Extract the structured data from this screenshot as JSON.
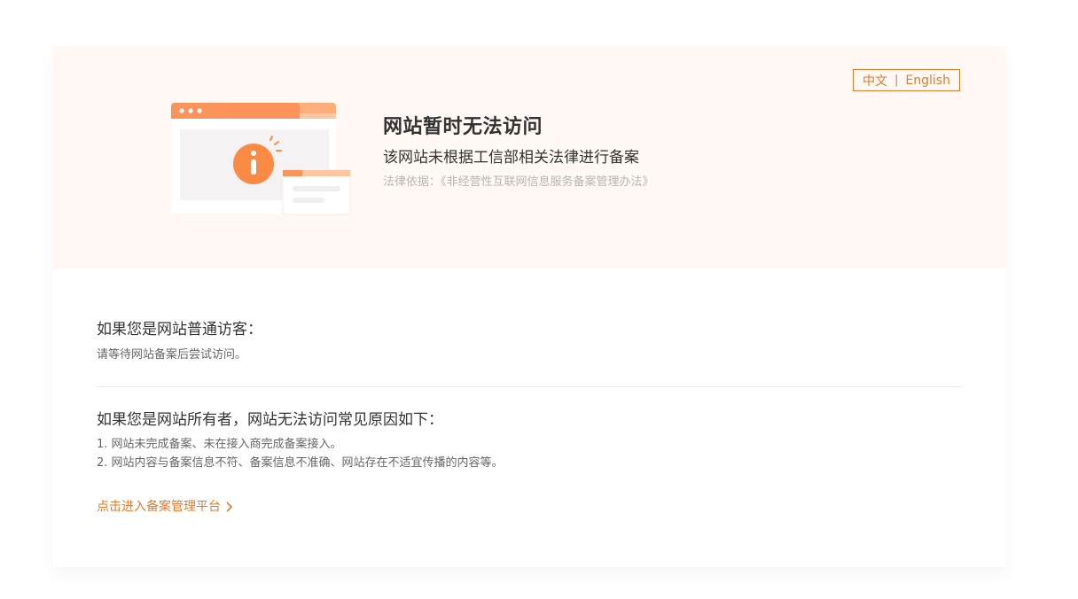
{
  "lang_switch": {
    "zh": "中文",
    "en": "English"
  },
  "banner": {
    "title": "网站暂时无法访问",
    "subtitle": "该网站未根据工信部相关法律进行备案",
    "law": "法律依据：《非经营性互联网信息服务备案管理办法》"
  },
  "visitor": {
    "heading": "如果您是网站普通访客：",
    "text": "请等待网站备案后尝试访问。"
  },
  "owner": {
    "heading": "如果您是网站所有者，网站无法访问常见原因如下：",
    "reasons": [
      "1. 网站未完成备案、未在接入商完成备案接入。",
      "2. 网站内容与备案信息不符、备案信息不准确、网站存在不适宜传播的内容等。"
    ]
  },
  "portal_link": {
    "label": "点击进入备案管理平台"
  },
  "colors": {
    "accent": "#e07b2b",
    "banner_bg": "#fff8f5",
    "title": "#333333"
  }
}
